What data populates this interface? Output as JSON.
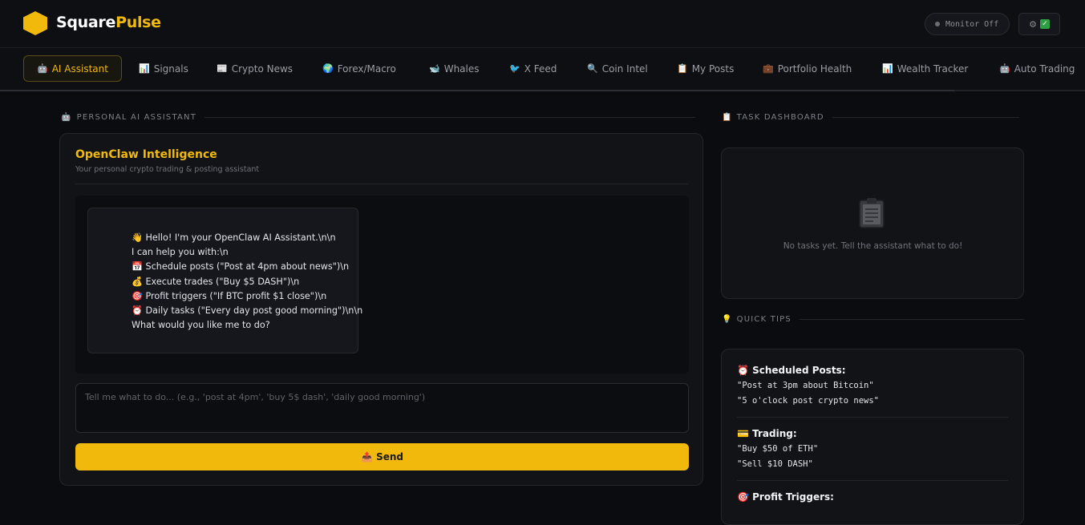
{
  "header": {
    "brand_part1": "Square",
    "brand_part2": "Pulse",
    "monitor_label": "Monitor Off",
    "settings_icon": "⚙",
    "status_icon": "✓"
  },
  "tabs": [
    {
      "icon": "🤖",
      "label": "AI Assistant",
      "active": true
    },
    {
      "icon": "📊",
      "label": "Signals"
    },
    {
      "icon": "📰",
      "label": "Crypto News"
    },
    {
      "icon": "🌍",
      "label": "Forex/Macro"
    },
    {
      "icon": "🐋",
      "label": "Whales"
    },
    {
      "icon": "🐦",
      "label": "X Feed"
    },
    {
      "icon": "🔍",
      "label": "Coin Intel"
    },
    {
      "icon": "📋",
      "label": "My Posts"
    },
    {
      "icon": "💼",
      "label": "Portfolio Health"
    },
    {
      "icon": "📊",
      "label": "Wealth Tracker"
    },
    {
      "icon": "🤖",
      "label": "Auto Trading"
    }
  ],
  "assistant": {
    "section_label": "PERSONAL AI ASSISTANT",
    "section_icon": "🤖",
    "title": "OpenClaw Intelligence",
    "subtitle": "Your personal crypto trading & posting assistant",
    "message_lines": [
      "👋 Hello! I'm your OpenClaw AI Assistant.\\n\\n",
      "I can help you with:\\n",
      "📅 Schedule posts (\"Post at 4pm about news\")\\n",
      "💰 Execute trades (\"Buy $5 DASH\")\\n",
      "🎯 Profit triggers (\"If BTC profit $1 close\")\\n",
      "⏰ Daily tasks (\"Every day post good morning\")\\n\\n",
      "What would you like me to do?"
    ],
    "input_placeholder": "Tell me what to do... (e.g., 'post at 4pm', 'buy 5$ dash', 'daily good morning')",
    "send_label": "📤 Send"
  },
  "tasks": {
    "section_label": "TASK DASHBOARD",
    "section_icon": "📋",
    "empty_text": "No tasks yet. Tell the assistant what to do!"
  },
  "tips": {
    "section_label": "QUICK TIPS",
    "section_icon": "💡",
    "groups": [
      {
        "title": "⏰ Scheduled Posts:",
        "lines": [
          "\"Post at 3pm about Bitcoin\"",
          "\"5 o'clock post crypto news\""
        ]
      },
      {
        "title": "💳 Trading:",
        "lines": [
          "\"Buy $50 of ETH\"",
          "\"Sell $10 DASH\""
        ]
      },
      {
        "title": "🎯 Profit Triggers:",
        "lines": []
      }
    ]
  },
  "colors": {
    "accent": "#f0b90b",
    "background": "#0b0c0f",
    "panel": "#121317"
  }
}
